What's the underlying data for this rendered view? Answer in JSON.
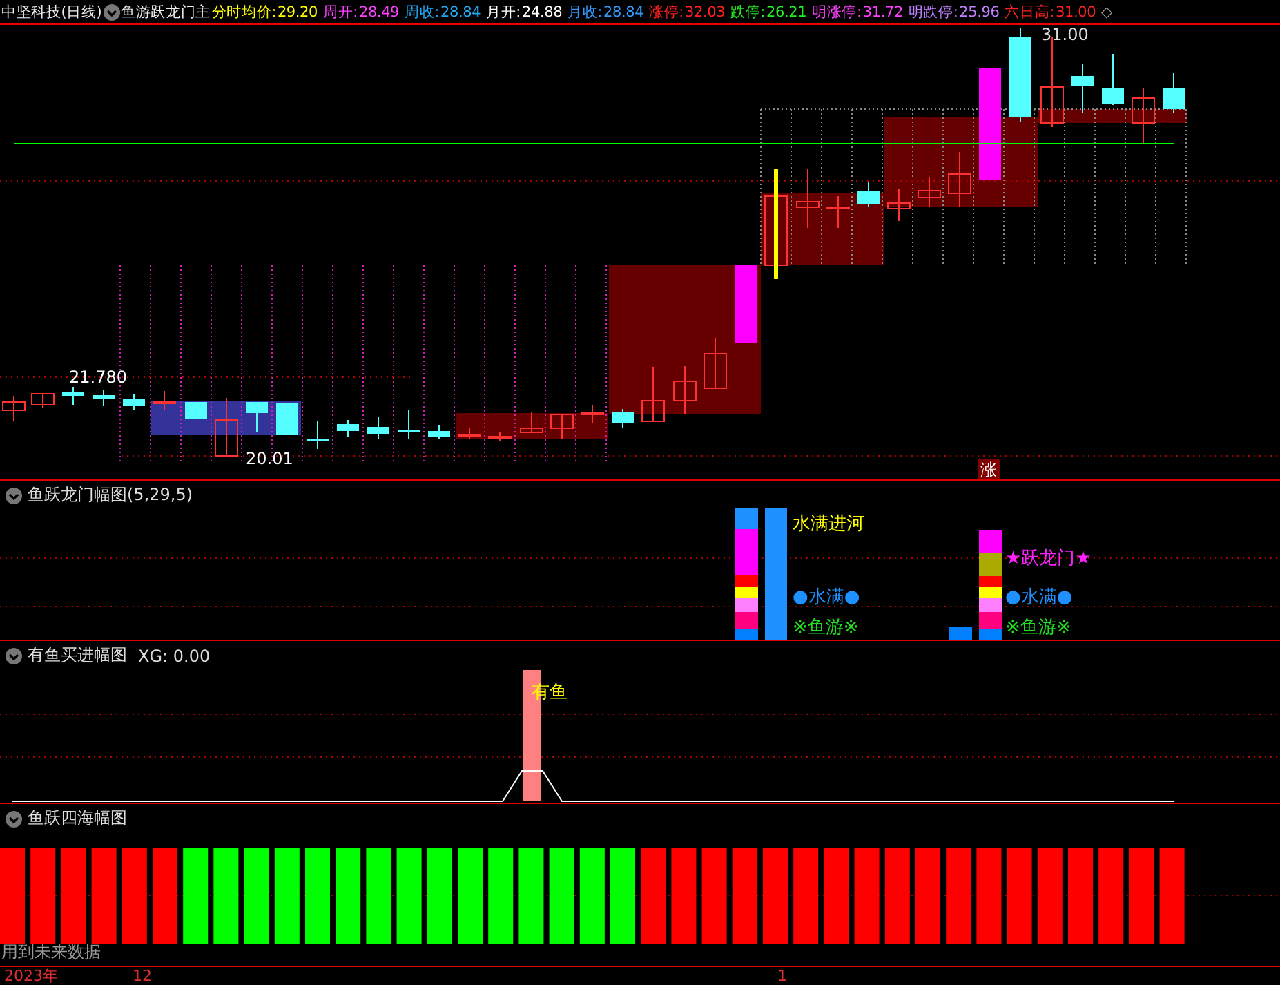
{
  "header": {
    "stock": "中坚科技(日线)",
    "indicator": "鱼游跃龙门主",
    "stats": [
      {
        "label": "分时均价:",
        "value": "29.20",
        "color": "#ffff00"
      },
      {
        "label": "周开:",
        "value": "28.49",
        "color": "#ff40ff"
      },
      {
        "label": "周收:",
        "value": "28.84",
        "color": "#20a8f0"
      },
      {
        "label": "月开:",
        "value": "24.88",
        "color": "#ffffff"
      },
      {
        "label": "月收:",
        "value": "28.84",
        "color": "#3399ff"
      },
      {
        "label": "涨停:",
        "value": "32.03",
        "color": "#ff2020"
      },
      {
        "label": "跌停:",
        "value": "26.21",
        "color": "#20f020"
      },
      {
        "label": "明涨停:",
        "value": "31.72",
        "color": "#ff40ff"
      },
      {
        "label": "明跌停:",
        "value": "25.96",
        "color": "#c080ff"
      },
      {
        "label": "六日高:",
        "value": "31.00",
        "color": "#ff2020"
      }
    ],
    "marker": "◇"
  },
  "main_chart": {
    "high_label": "21.780",
    "low_label": "20.01",
    "peak_label": "31.00",
    "limit_badge": "涨"
  },
  "panels": [
    {
      "kind": "dragon",
      "title": "鱼跃龙门幅图(5,29,5)",
      "labels": [
        {
          "text": "水满进河",
          "color": "#ffff00"
        },
        {
          "text": "★跃龙门★",
          "color": "#ff20ff"
        },
        {
          "text": "●水满●",
          "color": "#1e90ff"
        },
        {
          "text": "●水满●",
          "color": "#1e90ff"
        },
        {
          "text": "※鱼游※",
          "color": "#20e020"
        },
        {
          "text": "※鱼游※",
          "color": "#20e020"
        }
      ]
    },
    {
      "kind": "fish",
      "title": "有鱼买进幅图",
      "reading": "XG: 0.00",
      "bar_label": "有鱼"
    },
    {
      "kind": "sea",
      "title": "鱼跃四海幅图",
      "note": "用到未来数据",
      "bars": [
        {
          "color": "#ff0000"
        },
        {
          "color": "#ff0000"
        },
        {
          "color": "#ff0000"
        },
        {
          "color": "#ff0000"
        },
        {
          "color": "#ff0000"
        },
        {
          "color": "#ff0000"
        },
        {
          "color": "#00ff00"
        },
        {
          "color": "#00ff00"
        },
        {
          "color": "#00ff00"
        },
        {
          "color": "#00ff00"
        },
        {
          "color": "#00ff00"
        },
        {
          "color": "#00ff00"
        },
        {
          "color": "#00ff00"
        },
        {
          "color": "#00ff00"
        },
        {
          "color": "#00ff00"
        },
        {
          "color": "#00ff00"
        },
        {
          "color": "#00ff00"
        },
        {
          "color": "#00ff00"
        },
        {
          "color": "#00ff00"
        },
        {
          "color": "#00ff00"
        },
        {
          "color": "#00ff00"
        },
        {
          "color": "#ff0000"
        },
        {
          "color": "#ff0000"
        },
        {
          "color": "#ff0000"
        },
        {
          "color": "#ff0000"
        },
        {
          "color": "#ff0000"
        },
        {
          "color": "#ff0000"
        },
        {
          "color": "#ff0000"
        },
        {
          "color": "#ff0000"
        },
        {
          "color": "#ff0000"
        },
        {
          "color": "#ff0000"
        },
        {
          "color": "#ff0000"
        },
        {
          "color": "#ff0000"
        },
        {
          "color": "#ff0000"
        },
        {
          "color": "#ff0000"
        },
        {
          "color": "#ff0000"
        },
        {
          "color": "#ff0000"
        },
        {
          "color": "#ff0000"
        },
        {
          "color": "#ff0000"
        }
      ]
    }
  ],
  "time_axis": [
    {
      "label": "2023年"
    },
    {
      "label": "12"
    },
    {
      "label": "1"
    }
  ]
}
